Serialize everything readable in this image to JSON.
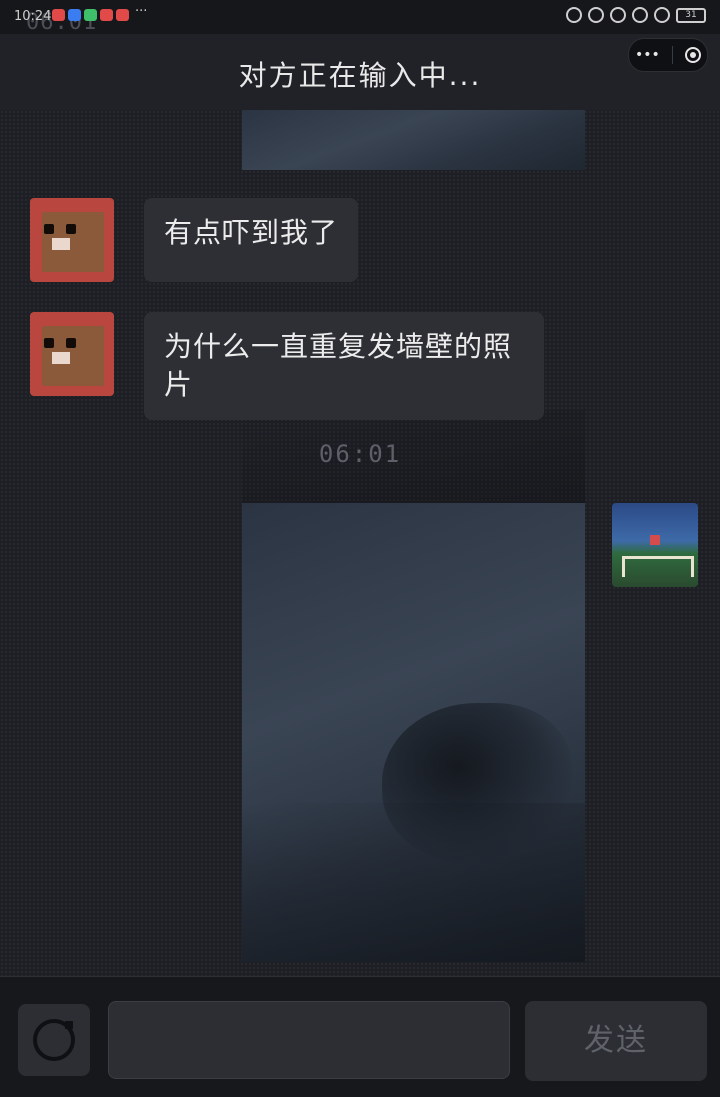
{
  "status_bar": {
    "time": "10:24",
    "ghost_clock": "06:01",
    "more": "···",
    "battery": "31",
    "notification_colors": [
      "#e24a4a",
      "#3b7cf0",
      "#3fbf6a",
      "#e24a4a",
      "#e24a4a"
    ]
  },
  "header": {
    "title": "对方正在输入中...",
    "capsule_more": "•••",
    "capsule_icons": [
      "more-icon",
      "close-circle-icon"
    ]
  },
  "messages": [
    {
      "side": "left",
      "type": "text",
      "text": "有点吓到我了"
    },
    {
      "side": "left",
      "type": "text",
      "text": "为什么一直重复发墙壁的照片"
    }
  ],
  "timestamp": "06:01",
  "input": {
    "camera_icon": "camera-icon",
    "placeholder": "",
    "send_label": "发送"
  },
  "colors": {
    "background": "#1b1c21",
    "bubble": "#2d2f35",
    "header": "#202228",
    "send_text": "#5f6269"
  }
}
